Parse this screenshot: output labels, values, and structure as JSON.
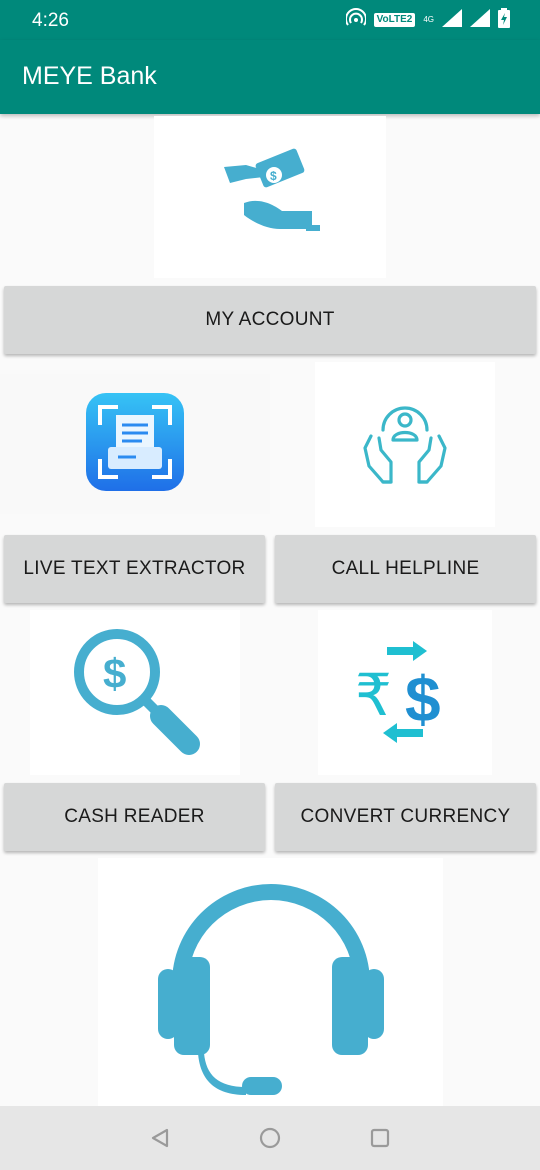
{
  "status_bar": {
    "time": "4:26",
    "volte": "VoLTE2",
    "network": "4G",
    "icons": [
      "hotspot-icon",
      "volte-icon",
      "signal-icon",
      "battery-icon"
    ]
  },
  "app_bar": {
    "title": "MEYE Bank"
  },
  "buttons": {
    "my_account": "MY ACCOUNT",
    "live_text_extractor": "LIVE TEXT EXTRACTOR",
    "call_helpline": "CALL HELPLINE",
    "cash_reader": "CASH READER",
    "convert_currency": "CONVERT CURRENCY"
  },
  "images": [
    "money-hand-icon",
    "scanner-icon",
    "helpline-hands-icon",
    "dollar-magnifier-icon",
    "currency-exchange-icon",
    "headset-icon"
  ],
  "nav_bar": {
    "icons": [
      "back-icon",
      "home-icon",
      "recents-icon"
    ]
  },
  "colors": {
    "primary": "#00897b",
    "icon_blue": "#46aecf",
    "button_bg": "#d6d7d7"
  }
}
